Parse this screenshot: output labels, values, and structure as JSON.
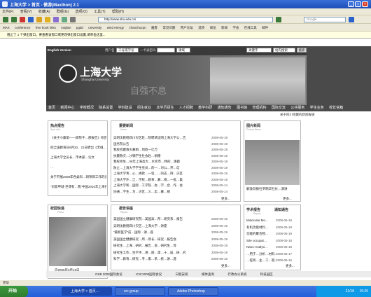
{
  "window": {
    "title": "上海大学 > 首页 - 傲游(Maxthon) 2.1",
    "min": "_",
    "max": "□",
    "close": "×"
  },
  "menu": [
    "文件(F)",
    "查看(V)",
    "收藏(A)",
    "群组(G)",
    "选项(O)",
    "工具(T)",
    "帮助(H)"
  ],
  "toolbar": {
    "address": "http://www.shu.edu.cn/",
    "search_placeholder": "Google",
    "labels": [
      "后退",
      "前进",
      "停止",
      "刷新",
      "主页",
      "收藏",
      "历史",
      "搜索",
      "打印"
    ]
  },
  "favorites": [
    "MAX",
    "conference",
    "free book links",
    "majilan",
    "pgdd",
    "university",
    "wind energy",
    "zhanzhuzpn",
    "雅客",
    "常见问题",
    "用户论坛",
    "选项",
    "阅览",
    "新闻",
    "学会",
    "在线工具",
    "邮件"
  ],
  "notice": "阻止了 1 个弹出窗口。要查看该窗口或更改弹出窗口设置,请单击这里...",
  "site": {
    "english": "English Version",
    "login": {
      "user_label": "用户名",
      "user_select": "工号或学号",
      "password_label": "一卡通密码",
      "domain": "请域",
      "search_value": "关键字",
      "search_scope": "站内搜索",
      "search_button": "搜索"
    },
    "logo": {
      "cn": "上海大学",
      "en": "Shanghai University",
      "motto": "自强不息"
    },
    "nav": [
      "首页",
      "新闻中心",
      "学校概况",
      "院系设置",
      "学科建设",
      "招生就业",
      "本学历招生",
      "人才招聘",
      "教学科研",
      "通知通告",
      "图书馆",
      "管理机构",
      "国际交流",
      "公共服务",
      "学生业务",
      "校长信箱"
    ],
    "ticker": "关于四川地震的新闻报道"
  },
  "hot": {
    "title": "热点报告",
    "sub": "Spot Info.",
    "items": [
      "《关于小康第——即院干…部报告》校区聘请",
      "四全国教育日5月20、21日聘出《无缝…报告》",
      "上海大学全员长…市本部…论文",
      "…",
      "关于开展2008年各类科…研项目工作的通知",
      "“创意申城·世博有…我”中国2010年上海世界…"
    ]
  },
  "news": {
    "title": "重要新闻",
    "sub": "News",
    "items": [
      {
        "t": "吴明沈教授四川灾区赴…院聘请证明上海大学公…告",
        "d": "2008-05-19"
      },
      {
        "t": "国务院公告",
        "d": "2008-05-19"
      },
      {
        "t": "我校抗震救灾募捐…到款一亿万",
        "d": "2008-05-19"
      },
      {
        "t": "抗震救灾…沙钢学生社会赴…捐赠",
        "d": "2008-05-19"
      },
      {
        "t": "我校师生…08年上海高大…水旁市…特的…课题",
        "d": "2008-05-19"
      },
      {
        "t": "防止…上海大学学生党员…的一…对公…开…信",
        "d": "2008-05-19"
      },
      {
        "t": "上海大学青…心…捐款…一笔……的支…持…灾区",
        "d": "2008-05-19"
      },
      {
        "t": "上海大学外…江…学校…教育…募…捐…一批…集",
        "d": "2008-05-19"
      },
      {
        "t": "上海大学和…国际…工学院…办…学…合…作…会",
        "d": "2008-05-14"
      },
      {
        "t": "协通…学生…为…灾区…义…卖…募…捐",
        "d": "2008-05-14"
      }
    ],
    "more": "更多..."
  },
  "pic": {
    "title": "图片新闻",
    "sub": "Picture News",
    "caption": "解放日报社罗明华社长…演讲",
    "more": "更多..."
  },
  "campus": {
    "title": "校园快递",
    "sub": "Photo",
    "counter": "自2006年3月19日",
    "counter_num": "31186128"
  },
  "report": {
    "title": "报告讲座",
    "sub": "Report",
    "items": [
      {
        "t": "美国国立健康研究院…美国高…所…研究系…报告",
        "d": "2008-05-19"
      },
      {
        "t": "吴明沈教授四川灾区…上海大学…讲座",
        "d": "2008-05-19"
      },
      {
        "t": "“最新医学”前…国际…讲…座",
        "d": "2008-05-19"
      },
      {
        "t": "美国国立健康研究…所…所长…研究…报告会",
        "d": "2008-05-19"
      },
      {
        "t": "研究生…上海…研究…报告…会…研究生…等",
        "d": "2008-05-19"
      },
      {
        "t": "研究生工作…生学术…讲…座…第…十…届…研…究",
        "d": "2008-05-19"
      },
      {
        "t": "科学…教育…研究…专…家…系…统…讲…座",
        "d": "2008-05-19"
      }
    ],
    "more": "更多..."
  },
  "academic": {
    "title": "学术报告",
    "title2": "通知通告",
    "sub": "Report",
    "items": [
      {
        "t": "Molecular Mo...",
        "d": "2008-05-19"
      },
      {
        "t": "有机功能材料…",
        "d": "2008-05-19"
      },
      {
        "t": "功能的聚合物…",
        "d": "2008-05-19"
      },
      {
        "t": "Site occupat…",
        "d": "2008-05-18"
      },
      {
        "t": "Nano-Analyti…",
        "d": "2008-05-18"
      },
      {
        "t": "…用于…分析…材料…",
        "d": "2008-05-17"
      },
      {
        "t": "…提高…主…工…程…",
        "d": "2008-05-16"
      }
    ],
    "more": "更多..."
  },
  "footer": [
    "OSB 2008国际会议",
    "ICIC2008国际会议",
    "日程安排",
    "媒体查询",
    "行政办公系统",
    "科技园区"
  ],
  "status": "完毕",
  "taskbar": {
    "start": "开始",
    "tasks": [
      "上海大学 > 首页…",
      "src group",
      "Adobe Photoshop"
    ],
    "clock": "15:20",
    "date": "21/18"
  }
}
